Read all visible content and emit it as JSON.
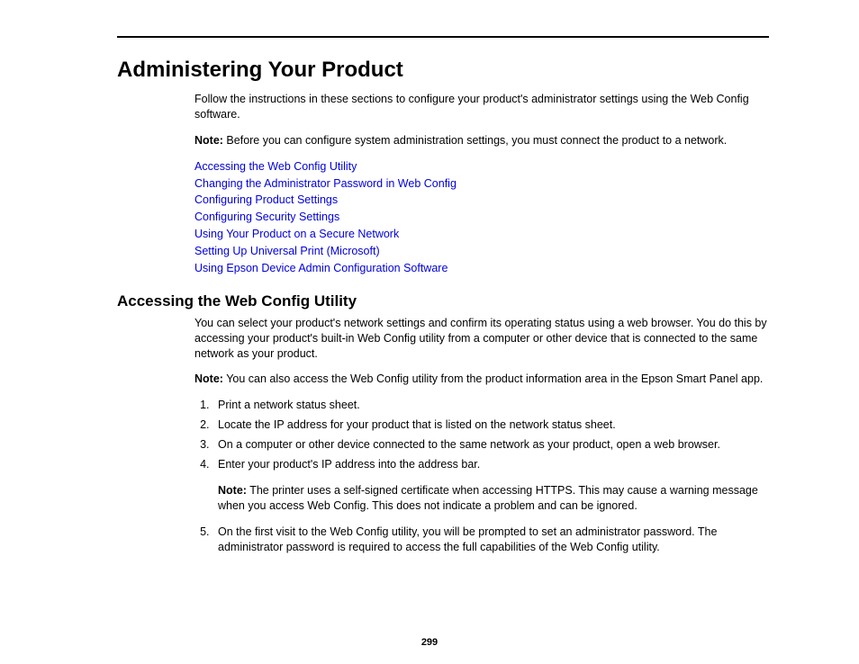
{
  "title": "Administering Your Product",
  "intro": "Follow the instructions in these sections to configure your product's administrator settings using the Web Config software.",
  "note1_label": "Note:",
  "note1_text": " Before you can configure system administration settings, you must connect the product to a network.",
  "links": [
    "Accessing the Web Config Utility",
    "Changing the Administrator Password in Web Config",
    "Configuring Product Settings",
    "Configuring Security Settings",
    "Using Your Product on a Secure Network",
    "Setting Up Universal Print (Microsoft)",
    "Using Epson Device Admin Configuration Software"
  ],
  "section_heading": "Accessing the Web Config Utility",
  "section_intro": "You can select your product's network settings and confirm its operating status using a web browser. You do this by accessing your product's built-in Web Config utility from a computer or other device that is connected to the same network as your product.",
  "note2_label": "Note:",
  "note2_text": " You can also access the Web Config utility from the product information area in the Epson Smart Panel app.",
  "steps": [
    "Print a network status sheet.",
    "Locate the IP address for your product that is listed on the network status sheet.",
    "On a computer or other device connected to the same network as your product, open a web browser.",
    "Enter your product's IP address into the address bar."
  ],
  "note3_label": "Note:",
  "note3_text": " The printer uses a self-signed certificate when accessing HTTPS. This may cause a warning message when you access Web Config. This does not indicate a problem and can be ignored.",
  "step5": "On the first visit to the Web Config utility, you will be prompted to set an administrator password. The administrator password is required to access the full capabilities of the Web Config utility.",
  "page_number": "299"
}
